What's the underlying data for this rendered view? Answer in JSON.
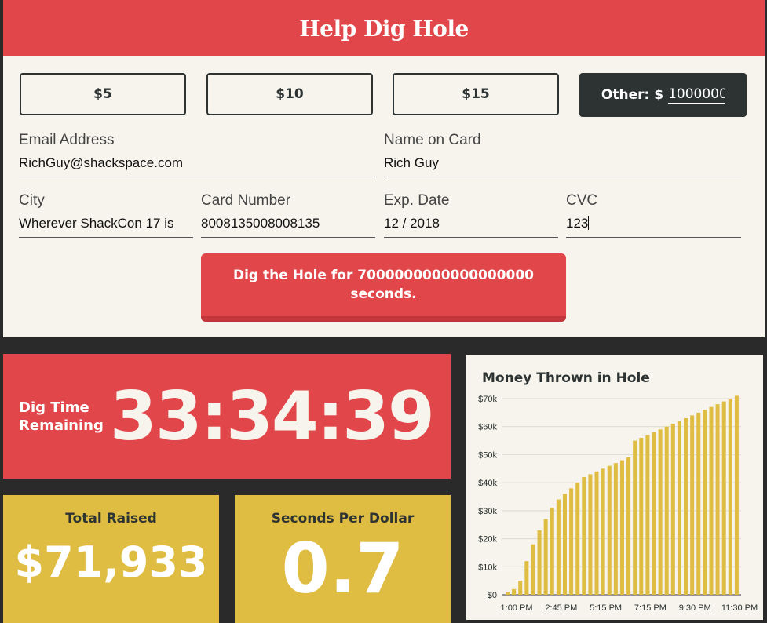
{
  "form": {
    "title": "Help Dig Hole",
    "amounts": [
      "$5",
      "$10",
      "$15"
    ],
    "other_label": "Other: $",
    "other_value": "1000000",
    "email_label": "Email Address",
    "email_value": "RichGuy@shackspace.com",
    "name_label": "Name on Card",
    "name_value": "Rich Guy",
    "city_label": "City",
    "city_value": "Wherever ShackCon 17 is",
    "card_label": "Card Number",
    "card_value": "8008135008008135",
    "exp_label": "Exp. Date",
    "exp_value": "12 / 2018",
    "cvc_label": "CVC",
    "cvc_value": "123",
    "submit_label": "Dig the Hole for 7000000000000000000 seconds."
  },
  "timer": {
    "label": "Dig Time Remaining",
    "value": "33:34:39"
  },
  "stats": {
    "total_raised_title": "Total Raised",
    "total_raised_value": "$71,933",
    "spd_title": "Seconds Per Dollar",
    "spd_value": "0.7"
  },
  "colors": {
    "red": "#e1474a",
    "dark": "#2c3332",
    "yellow": "#dfbd42",
    "cream": "#f6f4ec"
  },
  "chart_data": {
    "type": "bar",
    "title": "Money Thrown in Hole",
    "y_ticks": [
      "$0",
      "$10k",
      "$20k",
      "$30k",
      "$40k",
      "$50k",
      "$60k",
      "$70k"
    ],
    "x_ticks": [
      "1:00 PM",
      "2:45 PM",
      "5:15 PM",
      "7:15 PM",
      "9:30 PM",
      "11:30 PM"
    ],
    "ylim": [
      0,
      70000
    ],
    "values": [
      1000,
      2000,
      5000,
      12000,
      18000,
      23000,
      27000,
      31000,
      34000,
      36000,
      38000,
      40000,
      42000,
      43000,
      44000,
      45000,
      46000,
      47000,
      48000,
      49000,
      55000,
      56000,
      57000,
      58000,
      59000,
      60000,
      61000,
      62000,
      63000,
      64000,
      65000,
      66000,
      67000,
      68000,
      69000,
      70000,
      71000
    ]
  }
}
